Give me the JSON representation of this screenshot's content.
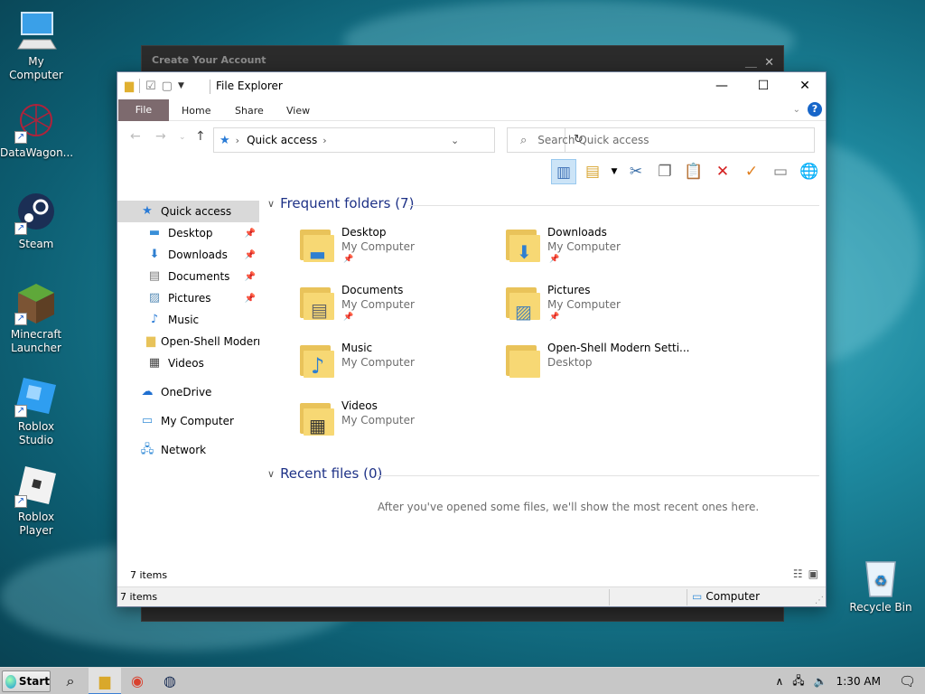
{
  "desktop": {
    "icons": [
      {
        "label": "My Computer"
      },
      {
        "label": "DataWagon..."
      },
      {
        "label": "Steam"
      },
      {
        "label": "Minecraft Launcher"
      },
      {
        "label": "Roblox Studio"
      },
      {
        "label": "Roblox Player"
      },
      {
        "label": "Recycle Bin"
      }
    ]
  },
  "back_window": {
    "title": "Create Your Account"
  },
  "explorer": {
    "title": "File Explorer",
    "tabs": {
      "file": "File",
      "home": "Home",
      "share": "Share",
      "view": "View"
    },
    "address": {
      "path": "Quick access"
    },
    "search": {
      "placeholder": "Search Quick access"
    },
    "nav": {
      "quick_access": "Quick access",
      "items": [
        {
          "label": "Desktop",
          "pinned": true
        },
        {
          "label": "Downloads",
          "pinned": true
        },
        {
          "label": "Documents",
          "pinned": true
        },
        {
          "label": "Pictures",
          "pinned": true
        },
        {
          "label": "Music",
          "pinned": false
        },
        {
          "label": "Open-Shell Modern",
          "pinned": false
        },
        {
          "label": "Videos",
          "pinned": false
        }
      ],
      "onedrive": "OneDrive",
      "my_computer": "My Computer",
      "network": "Network"
    },
    "frequent": {
      "header": "Frequent folders (7)",
      "folders": [
        {
          "name": "Desktop",
          "location": "My Computer",
          "pinned": true,
          "icon": "desktop-icon"
        },
        {
          "name": "Downloads",
          "location": "My Computer",
          "pinned": true,
          "icon": "download-arrow-icon"
        },
        {
          "name": "Documents",
          "location": "My Computer",
          "pinned": true,
          "icon": "document-icon"
        },
        {
          "name": "Pictures",
          "location": "My Computer",
          "pinned": true,
          "icon": "picture-icon"
        },
        {
          "name": "Music",
          "location": "My Computer",
          "pinned": false,
          "icon": "music-note-icon"
        },
        {
          "name": "Open-Shell Modern Setti...",
          "location": "Desktop",
          "pinned": false,
          "icon": "folder-icon"
        },
        {
          "name": "Videos",
          "location": "My Computer",
          "pinned": false,
          "icon": "film-icon"
        }
      ]
    },
    "recent": {
      "header": "Recent files (0)",
      "empty": "After you've opened some files, we'll show the most recent ones here."
    },
    "status": {
      "items": "7 items",
      "bar_items": "7 items",
      "computer": "Computer"
    }
  },
  "taskbar": {
    "start": "Start",
    "time": "1:30 AM"
  },
  "colors": {
    "accent": "#1e3287",
    "file_tab": "#7d6a6e",
    "taskbar": "#c7c7c7"
  }
}
